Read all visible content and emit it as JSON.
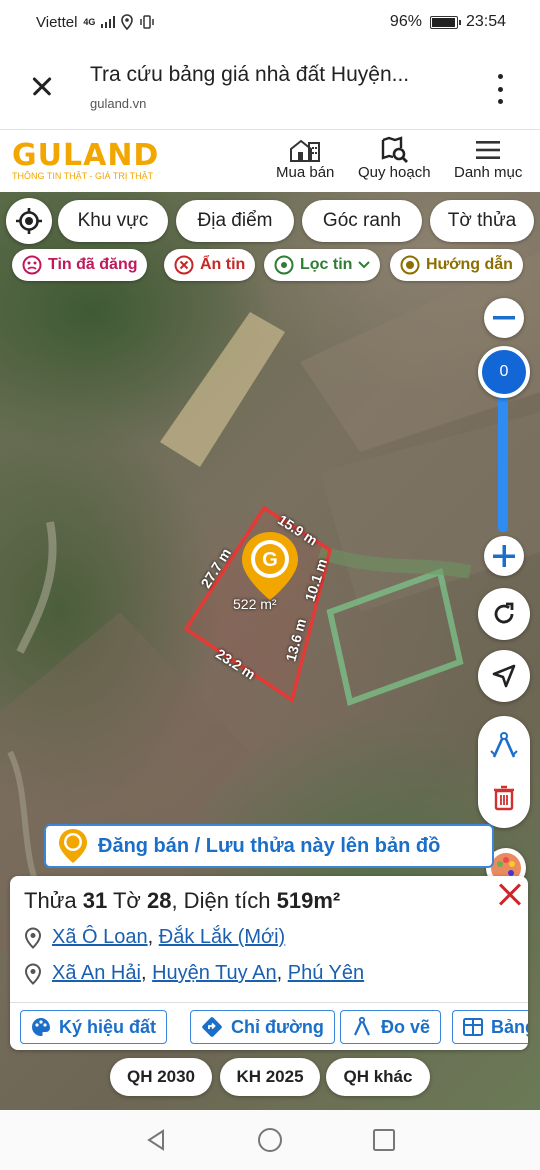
{
  "status": {
    "carrier": "Viettel",
    "network": "4G",
    "battery": "96%",
    "battery_level": 0.96,
    "time": "23:54"
  },
  "browser": {
    "title": "Tra cứu bảng giá nhà đất Huyện...",
    "url": "guland.vn"
  },
  "site": {
    "logo": "GULAND",
    "tagline": "THÔNG TIN THẬT - GIÁ TRỊ THẬT",
    "nav": [
      {
        "label": "Mua bán",
        "icon": "building-icon"
      },
      {
        "label": "Quy hoạch",
        "icon": "map-search-icon"
      },
      {
        "label": "Danh mục",
        "icon": "menu-icon"
      }
    ]
  },
  "filters": {
    "primary": [
      "Khu vực",
      "Địa điểm",
      "Góc ranh",
      "Tờ thửa"
    ],
    "secondary": [
      {
        "label": "Tin đã đăng",
        "color": "#c2185b",
        "icon": "face-icon"
      },
      {
        "label": "Ẩn tin",
        "color": "#c62828",
        "icon": "circle-x-icon"
      },
      {
        "label": "Lọc tin",
        "color": "#2e7d32",
        "icon": "location-pin-icon"
      },
      {
        "label": "Hướng dẫn",
        "color": "#8d6e00",
        "icon": "play-circle-icon"
      }
    ]
  },
  "map": {
    "zoom_level": "0",
    "parcel": {
      "area_label": "522 m²",
      "edges": [
        "15.9 m",
        "10.1 m",
        "13.6 m",
        "23.2 m",
        "27.7 m"
      ]
    },
    "action": "Đăng bán / Lưu thửa này lên bản đồ",
    "marker_letter": "G"
  },
  "info": {
    "parcel_prefix": "Thửa",
    "parcel_no": "31",
    "sheet_prefix": "Tờ",
    "sheet_no": "28",
    "area_prefix": ", Diện tích",
    "area": "519m²",
    "line1": {
      "commune": "Xã Ô Loan",
      "province": "Đắk Lắk (Mới)"
    },
    "line2": {
      "commune": "Xã An Hải",
      "district": "Huyện Tuy An",
      "province": "Phú Yên"
    },
    "separator": ",",
    "tools": [
      "Ký hiệu đất",
      "Chỉ đường",
      "Đo vẽ",
      "Bảng"
    ]
  },
  "plans": [
    "QH 2030",
    "KH 2025",
    "QH khác"
  ],
  "colors": {
    "brand": "#f2a600",
    "accent": "#1b6fc9",
    "boundary": "#e53935"
  }
}
